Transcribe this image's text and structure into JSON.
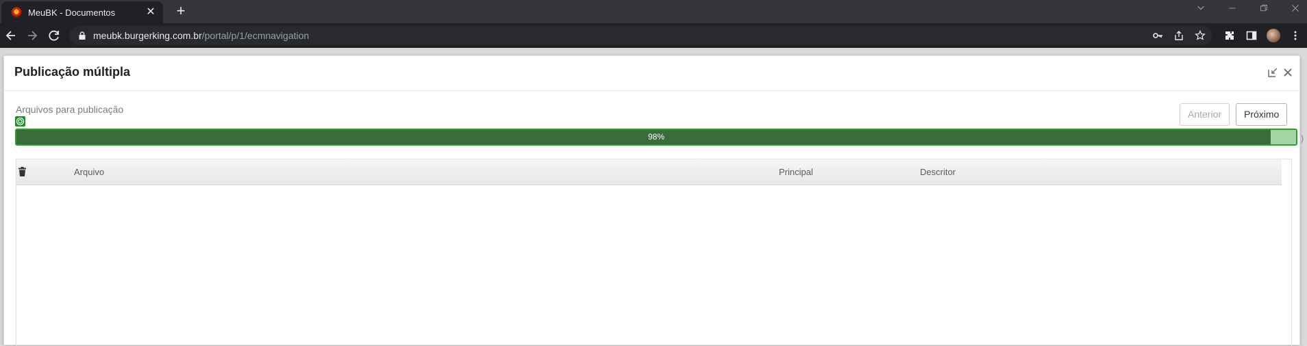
{
  "browser": {
    "tab_title": "MeuBK - Documentos",
    "tab_close": "✕",
    "new_tab": "+",
    "url_host": "meubk.burgerking.com.br",
    "url_path": "/portal/p/1/ecmnavigation"
  },
  "modal": {
    "title": "Publicação múltipla"
  },
  "upload": {
    "section_label": "Arquivos para publicação",
    "prev_label": "Anterior",
    "next_label": "Próximo",
    "progress_percent": 98,
    "progress_text": "98%"
  },
  "table": {
    "columns": {
      "file": "Arquivo",
      "main": "Principal",
      "descriptor": "Descritor"
    },
    "rows": []
  },
  "colors": {
    "progress_fill": "#3a6b3a",
    "progress_track": "#a5d6a3",
    "progress_border": "#2f9e2f"
  }
}
